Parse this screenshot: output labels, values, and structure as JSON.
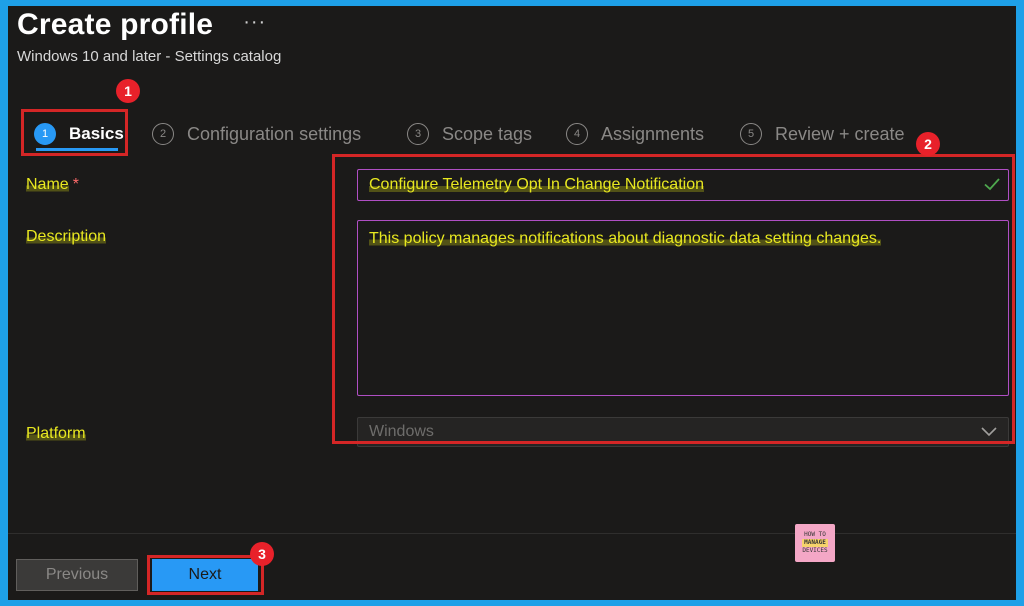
{
  "header": {
    "title": "Create profile",
    "more_label": "···",
    "subtitle": "Windows 10 and later - Settings catalog"
  },
  "tabs": [
    {
      "step": "1",
      "label": "Basics",
      "active": true
    },
    {
      "step": "2",
      "label": "Configuration settings",
      "active": false
    },
    {
      "step": "3",
      "label": "Scope tags",
      "active": false
    },
    {
      "step": "4",
      "label": "Assignments",
      "active": false
    },
    {
      "step": "5",
      "label": "Review + create",
      "active": false
    }
  ],
  "form": {
    "name_label": "Name",
    "required_marker": "*",
    "name_value": "Configure Telemetry Opt In Change Notification",
    "description_label": "Description",
    "description_value": "This policy manages notifications about diagnostic data setting changes.",
    "platform_label": "Platform",
    "platform_value": "Windows"
  },
  "footer": {
    "previous_label": "Previous",
    "next_label": "Next"
  },
  "annotations": {
    "badge_1": "1",
    "badge_2": "2",
    "badge_3": "3"
  },
  "logo": {
    "line1": "HOW TO",
    "line2": "MANAGE",
    "line3": "DEVICES"
  },
  "colors": {
    "accent": "#2899f5",
    "annotation_red": "#d42626",
    "highlight_text": "#e8e820",
    "input_border": "#b04fc4"
  }
}
